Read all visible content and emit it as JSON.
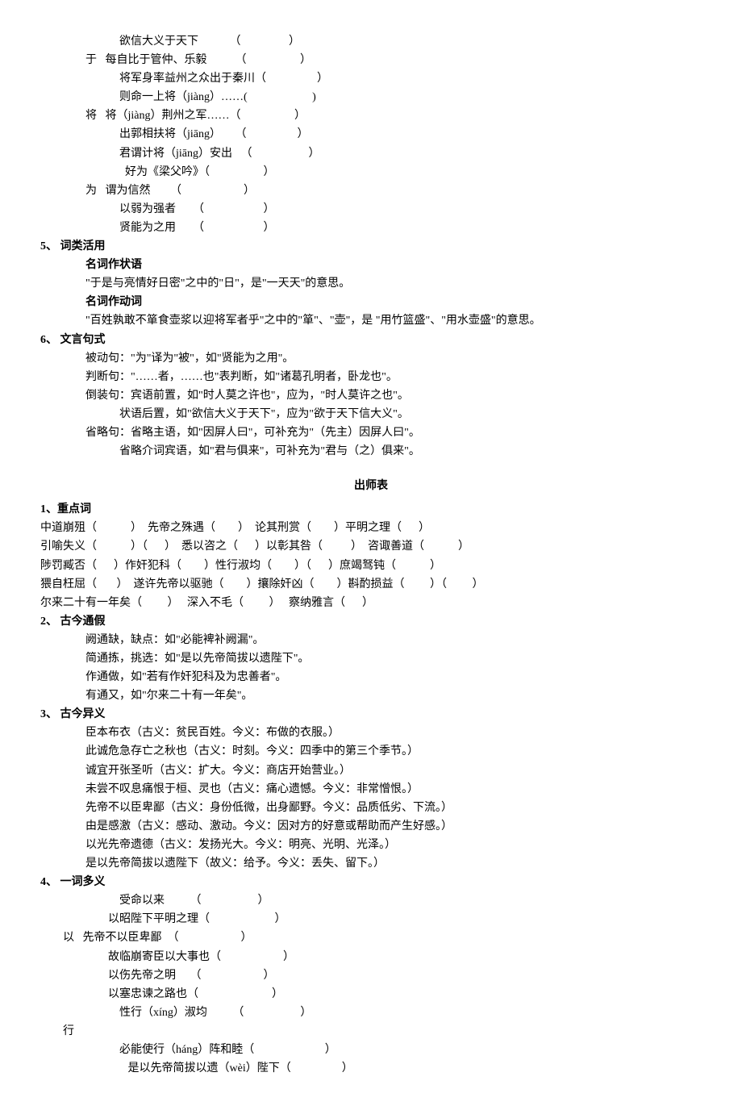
{
  "top_lines": [
    {
      "cls": "indent-4",
      "text": "欲信大义于天下           （                 ）"
    },
    {
      "cls": "indent-2",
      "text": "于   每自比于管仲、乐毅          （                   ）"
    },
    {
      "cls": "indent-4",
      "text": "将军身率益州之众出于秦川（                  ）"
    },
    {
      "cls": "indent-4",
      "text": "则命一上将（jiàng）……(                       )"
    },
    {
      "cls": "indent-2",
      "text": "将   将（jiàng）荆州之军……（                   ）"
    },
    {
      "cls": "indent-4",
      "text": "出郭相扶将（jiāng）     （                  ）"
    },
    {
      "cls": "indent-4",
      "text": "君谓计将（jiāng）安出   （                    ）"
    },
    {
      "cls": "indent-4",
      "text": "  好为《梁父吟》（                   ）"
    },
    {
      "cls": "indent-2",
      "text": "为   谓为信然       （                      ）"
    },
    {
      "cls": "indent-4",
      "text": "以弱为强者      （                     ）"
    },
    {
      "cls": "indent-4",
      "text": "贤能为之用      （                     ）"
    }
  ],
  "s5": {
    "head": "5、 词类活用",
    "nz_title": "名词作状语",
    "nz_line": "\"于是与亮情好日密\"之中的\"日\"，是\"一天天\"的意思。",
    "nd_title": "名词作动词",
    "nd_line": "\"百姓孰敢不箪食壶浆以迎将军者乎\"之中的\"箪\"、\"壶\"，是  \"用竹篮盛\"、\"用水壶盛\"的意思。"
  },
  "s6": {
    "head": "6、 文言句式",
    "lines": [
      {
        "cls": "indent-2",
        "text": "被动句：\"为\"译为\"被\"，如\"贤能为之用\"。"
      },
      {
        "cls": "indent-2",
        "text": "判断句：\"……者，……也\"表判断，如\"诸葛孔明者，卧龙也\"。"
      },
      {
        "cls": "indent-2",
        "text": "倒装句：宾语前置，如\"时人莫之许也\"，应为，\"时人莫许之也\"。"
      },
      {
        "cls": "indent-4",
        "text": "状语后置，如\"欲信大义于天下\"，应为\"欲于天下信大义\"。"
      },
      {
        "cls": "indent-2",
        "text": "省略句：省略主语，如\"因屏人曰\"，可补充为\"（先主）因屏人曰\"。"
      },
      {
        "cls": "indent-4",
        "text": "省略介词宾语，如\"君与俱来\"，可补充为\"君与（之）俱来\"。"
      }
    ]
  },
  "title2": "出师表",
  "b1": {
    "head": "1、重点词",
    "lines": [
      "中道崩殂（            ）  先帝之殊遇（        ）  论其刑赏（        ）平明之理（      ）",
      "引喻失义（            ）（      ）  悉以咨之（      ）以彰其咎（          ）  咨诹善道（            ）",
      "陟罚臧否（      ）作奸犯科（        ）性行淑均（        ）（      ）庶竭驽钝（            ）",
      "猥自枉屈（       ）  遂许先帝以驱驰（        ）攘除奸凶（        ）斟酌损益（         ）（         ）",
      "尔来二十有一年矣（         ）   深入不毛（         ）   察纳雅言（      ）"
    ]
  },
  "b2": {
    "head": "2、 古今通假",
    "lines": [
      "阙通缺，缺点：如\"必能裨补阙漏\"。",
      "简通拣，挑选：如\"是以先帝简拔以遗陛下\"。",
      "作通做，如\"若有作奸犯科及为忠善者\"。",
      "有通又，如\"尔来二十有一年矣\"。"
    ]
  },
  "b3": {
    "head": "3、 古今异义",
    "lines": [
      "臣本布衣（古义：贫民百姓。今义：布做的衣服。）",
      "此诚危急存亡之秋也（古义：时刻。今义：四季中的第三个季节。）",
      "诚宜开张圣听（古义：扩大。今义：商店开始营业。）",
      "未尝不叹息痛恨于桓、灵也（古义：痛心遗憾。今义：非常憎恨。）",
      "先帝不以臣卑鄙（古义：身份低微，出身鄙野。今义：品质低劣、下流。）",
      "由是感激（古义：感动、激动。今义：因对方的好意或帮助而产生好感。）",
      "以光先帝遗德（古义：发扬光大。今义：明亮、光明、光泽。）",
      "是以先帝简拔以遗陛下（故义：给予。今义：丢失、留下。）"
    ]
  },
  "b4": {
    "head": "4、 一词多义",
    "lines": [
      {
        "cls": "indent-4",
        "text": "受命以来         （                    ）"
      },
      {
        "cls": "indent-3",
        "text": "以昭陛下平明之理（                       ）"
      },
      {
        "cls": "indent-1",
        "text": "以   先帝不以臣卑鄙  （                      ）"
      },
      {
        "cls": "indent-3",
        "text": "故临崩寄臣以大事也（                      ）"
      },
      {
        "cls": "indent-3",
        "text": "以伤先帝之明     （                      ）"
      },
      {
        "cls": "indent-3",
        "text": "以塞忠谏之路也（                          ）"
      },
      {
        "cls": "indent-4",
        "text": "性行（xíng）淑均         （                    ）"
      },
      {
        "cls": "indent-1",
        "text": "行"
      },
      {
        "cls": "indent-4",
        "text": "必能使行（háng）阵和睦（                         ）"
      },
      {
        "cls": "indent-4",
        "text": "   是以先帝简拔以遗（wèi）陛下（                  ）"
      }
    ]
  }
}
